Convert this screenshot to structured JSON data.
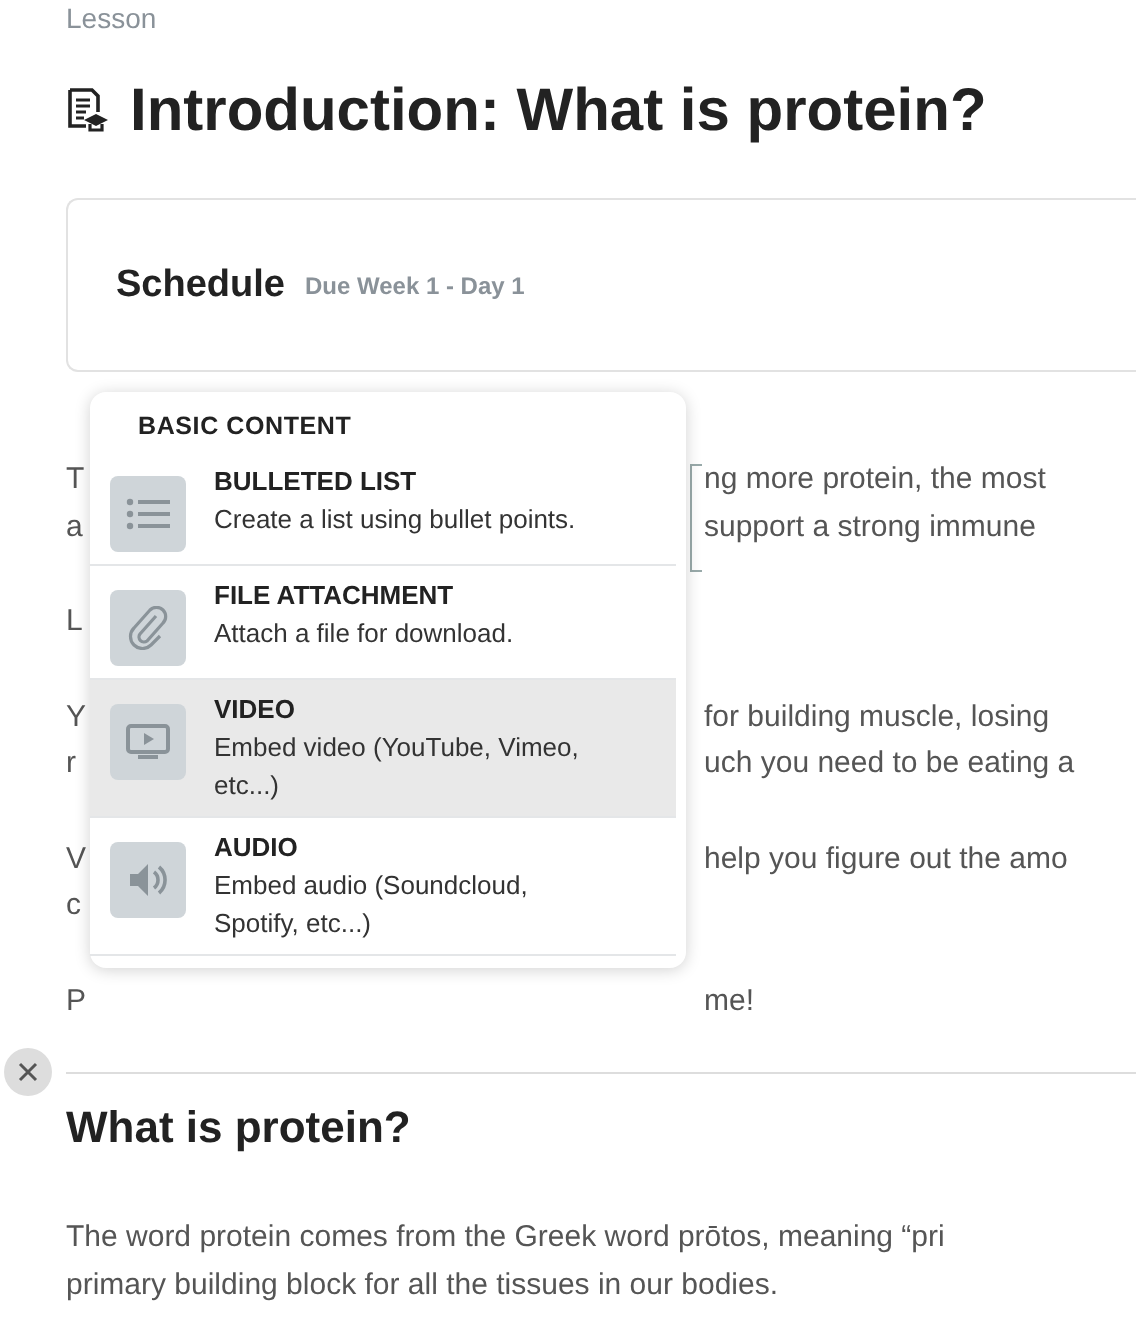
{
  "breadcrumb": "Lesson",
  "title": "Introduction: What is protein?",
  "schedule": {
    "label": "Schedule",
    "due": "Due Week 1 - Day 1"
  },
  "body_paragraphs": [
    {
      "lines": [
        {
          "left": "T",
          "right": "ng more protein, the most"
        },
        {
          "left": "a",
          "right": "support a strong immune"
        }
      ]
    },
    {
      "lines": [
        {
          "left": "L"
        }
      ]
    },
    {
      "lines": [
        {
          "left": "Y",
          "right": "for building muscle, losing"
        },
        {
          "left": "r",
          "right": "uch you need to be eating a"
        }
      ]
    },
    {
      "lines": [
        {
          "left": "V",
          "right": "help you figure out the amo"
        },
        {
          "left": "c"
        }
      ]
    },
    {
      "lines": [
        {
          "left": "P",
          "right": "me!"
        }
      ]
    }
  ],
  "insert_menu": {
    "heading": "BASIC CONTENT",
    "items": [
      {
        "kind": "list",
        "title": "BULLETED LIST",
        "description": "Create a list using bullet points.",
        "selected": false
      },
      {
        "kind": "attachment",
        "title": "FILE ATTACHMENT",
        "description": "Attach a file for download.",
        "selected": false
      },
      {
        "kind": "video",
        "title": "VIDEO",
        "description": "Embed video (YouTube, Vimeo, etc...)",
        "selected": true
      },
      {
        "kind": "audio",
        "title": "AUDIO",
        "description": "Embed audio (Soundcloud, Spotify, etc...)",
        "selected": false
      }
    ]
  },
  "section": {
    "heading": "What is protein?",
    "paragraph_lines": [
      "The word protein comes from the Greek word prōtos, meaning “pri",
      "primary building block for all the tissues in our bodies."
    ]
  }
}
